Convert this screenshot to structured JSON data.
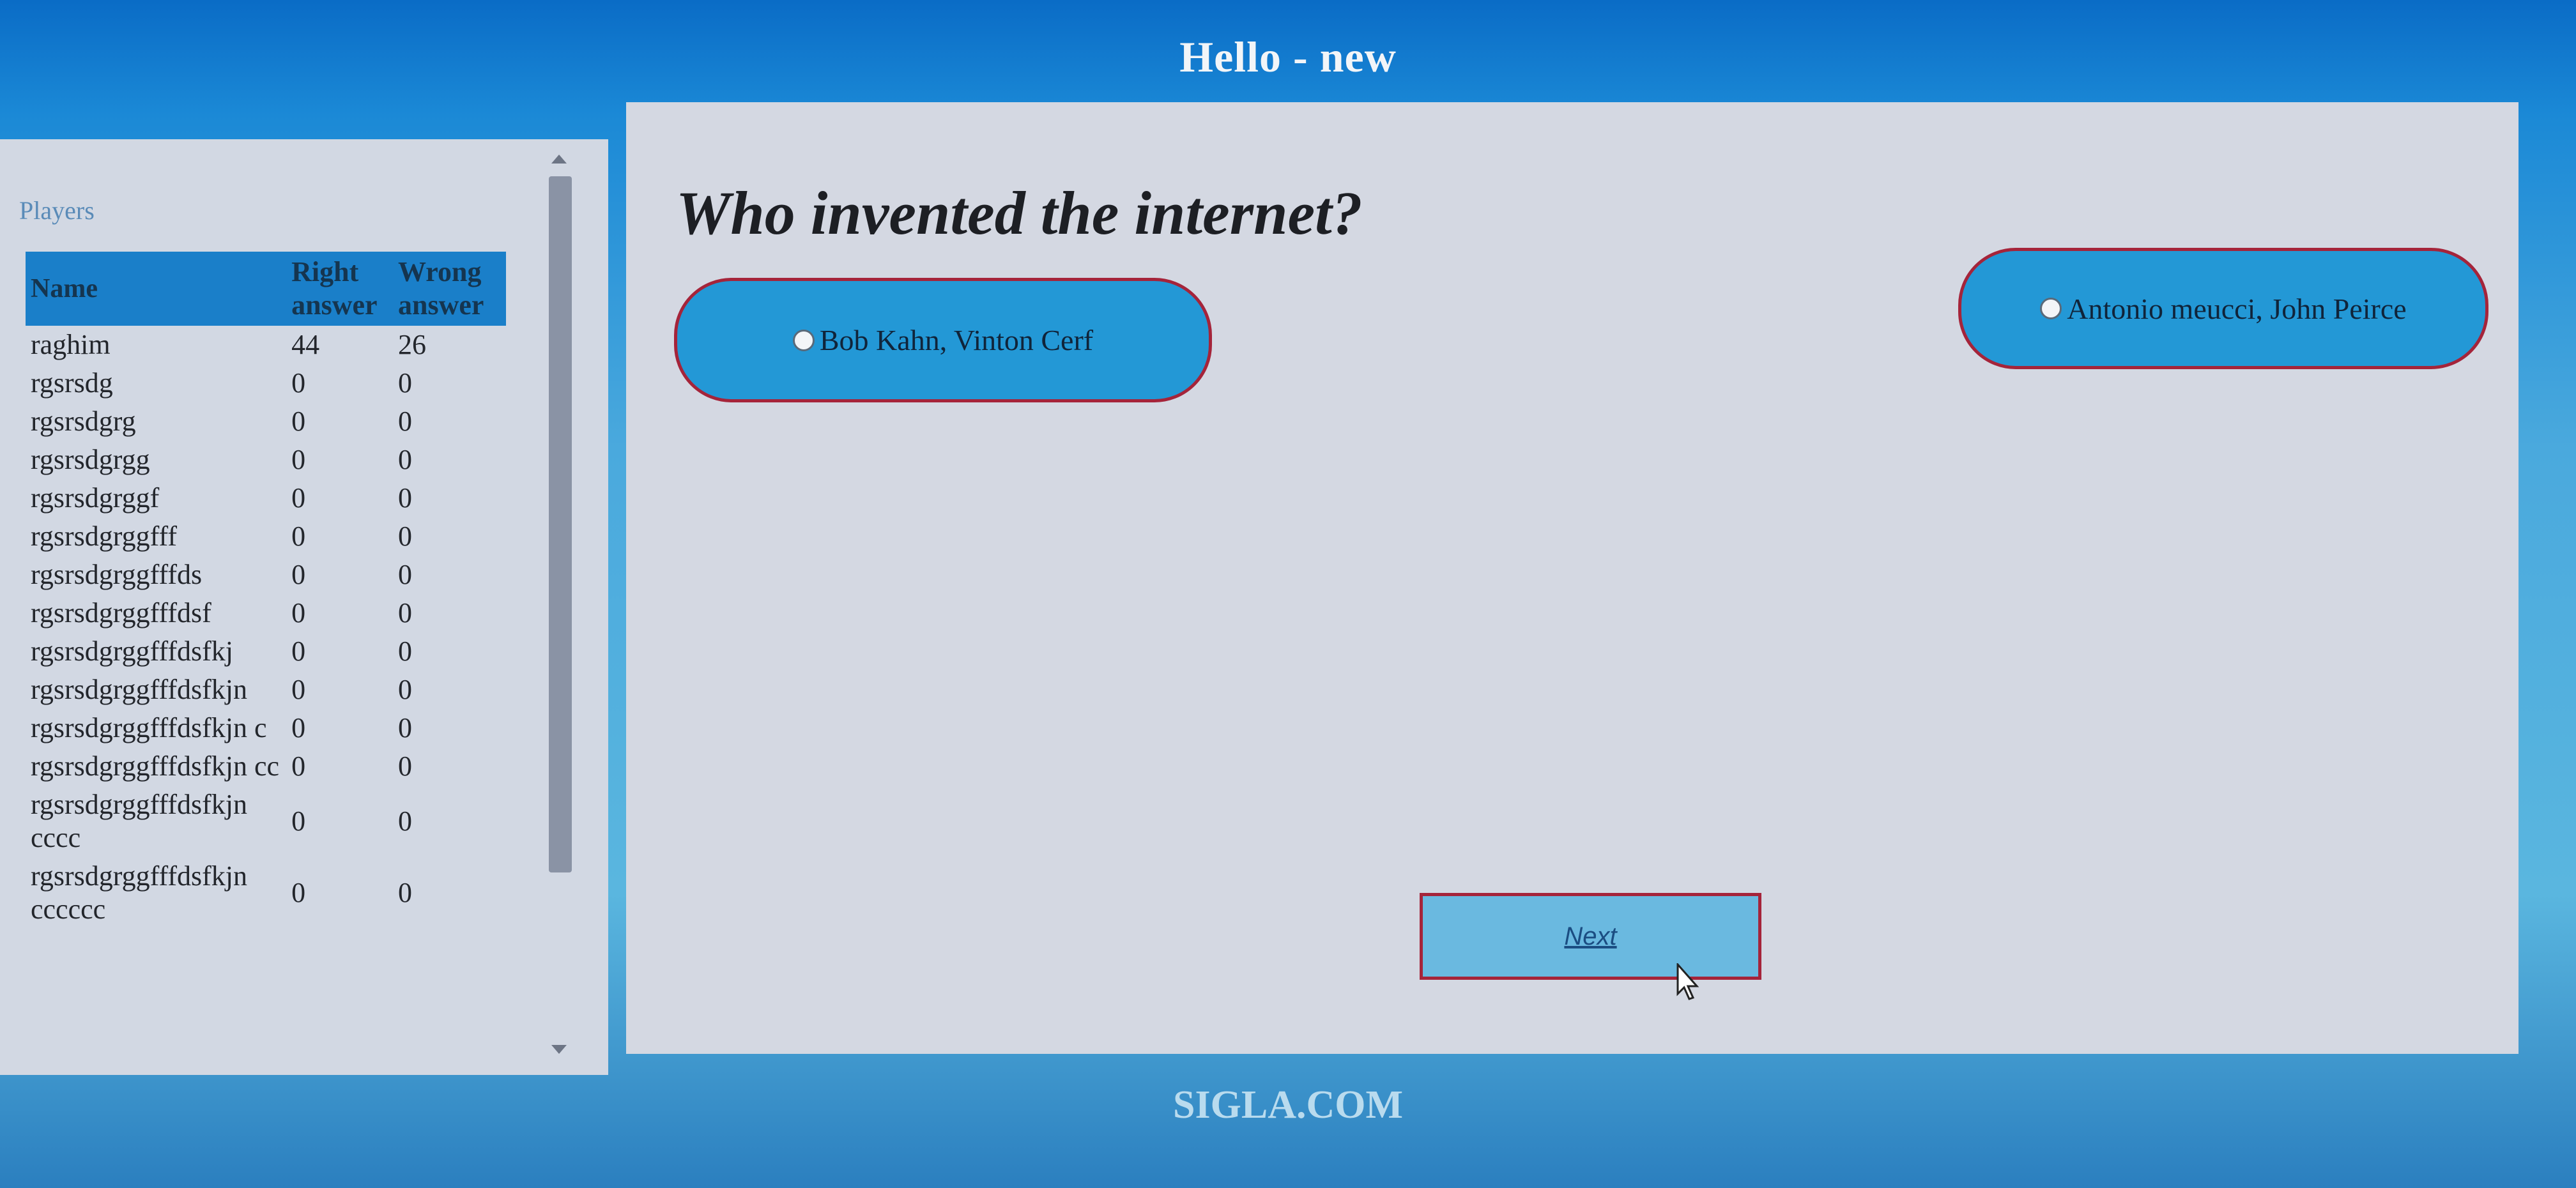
{
  "app": {
    "title": "Hello - new",
    "footer_brand": "SIGLA.COM"
  },
  "players": {
    "title": "Players",
    "columns": {
      "name": "Name",
      "right": "Right answer",
      "wrong": "Wrong answer"
    },
    "rows": [
      {
        "name": "raghim",
        "right": "44",
        "wrong": "26"
      },
      {
        "name": "rgsrsdg",
        "right": "0",
        "wrong": "0"
      },
      {
        "name": "rgsrsdgrg",
        "right": "0",
        "wrong": "0"
      },
      {
        "name": "rgsrsdgrgg",
        "right": "0",
        "wrong": "0"
      },
      {
        "name": "rgsrsdgrggf",
        "right": "0",
        "wrong": "0"
      },
      {
        "name": "rgsrsdgrggfff",
        "right": "0",
        "wrong": "0"
      },
      {
        "name": "rgsrsdgrggfffds",
        "right": "0",
        "wrong": "0"
      },
      {
        "name": "rgsrsdgrggfffdsf",
        "right": "0",
        "wrong": "0"
      },
      {
        "name": "rgsrsdgrggfffdsfkj",
        "right": "0",
        "wrong": "0"
      },
      {
        "name": "rgsrsdgrggfffdsfkjn",
        "right": "0",
        "wrong": "0"
      },
      {
        "name": "rgsrsdgrggfffdsfkjn c",
        "right": "0",
        "wrong": "0"
      },
      {
        "name": "rgsrsdgrggfffdsfkjn cc",
        "right": "0",
        "wrong": "0"
      },
      {
        "name": "rgsrsdgrggfffdsfkjn cccc",
        "right": "0",
        "wrong": "0"
      },
      {
        "name": "rgsrsdgrggfffdsfkjn cccccc",
        "right": "0",
        "wrong": "0"
      }
    ]
  },
  "quiz": {
    "question": "Who invented the internet?",
    "answers": [
      {
        "label": "Bob Kahn, Vinton Cerf",
        "selected": false
      },
      {
        "label": "Antonio meucci, John Peirce",
        "selected": false
      }
    ],
    "next_label": "Next"
  },
  "colors": {
    "header_bg": "#0a6cc6",
    "answer_bg": "#2398d6",
    "answer_border": "#a5243a",
    "panel_bg": "#d4d8e2",
    "table_header_bg": "#1a7fc9"
  },
  "icons": {
    "cursor": "mouse-pointer-icon",
    "radio": "radio-circle-icon"
  }
}
